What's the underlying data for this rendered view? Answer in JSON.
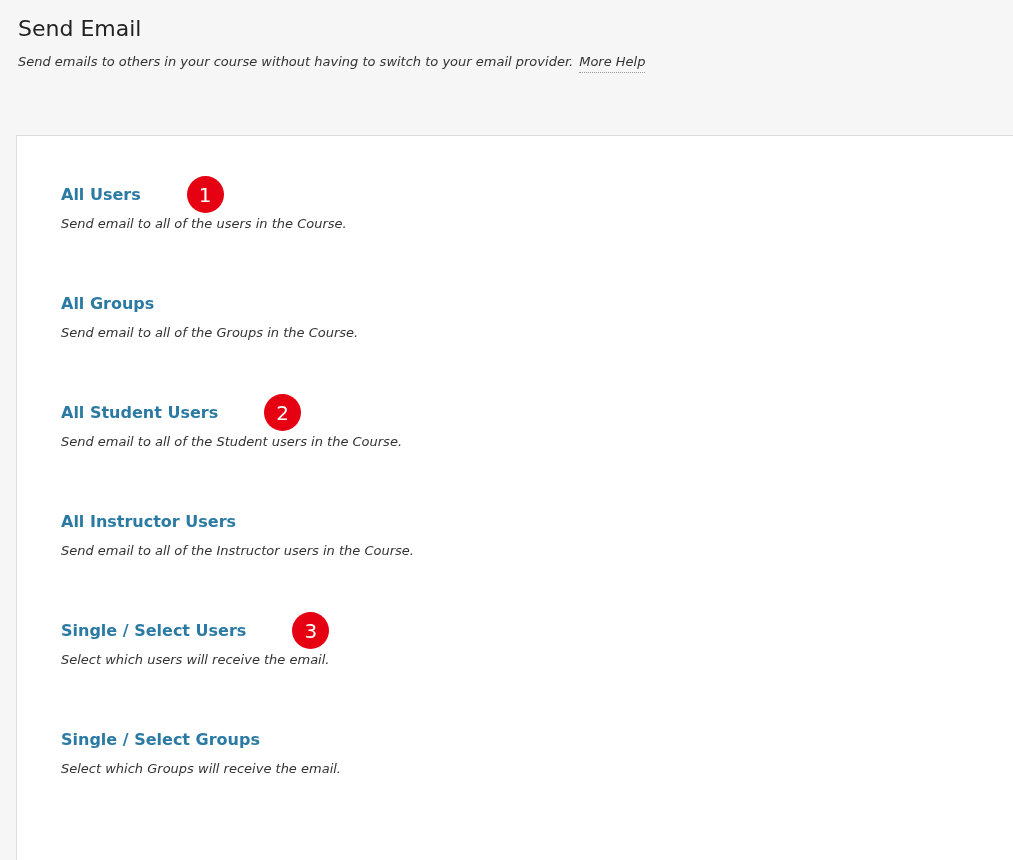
{
  "header": {
    "title": "Send Email",
    "description": "Send emails to others in your course without having to switch to your email provider.",
    "help_link": "More Help"
  },
  "options": [
    {
      "title": "All Users",
      "description": "Send email to all of the users in the Course.",
      "marker": "1"
    },
    {
      "title": "All Groups",
      "description": "Send email to all of the Groups in the Course."
    },
    {
      "title": "All Student Users",
      "description": "Send email to all of the Student users in the Course.",
      "marker": "2"
    },
    {
      "title": "All Instructor Users",
      "description": "Send email to all of the Instructor users in the Course."
    },
    {
      "title": "Single / Select Users",
      "description": "Select which users will receive the email.",
      "marker": "3"
    },
    {
      "title": "Single / Select Groups",
      "description": "Select which Groups will receive the email."
    }
  ]
}
